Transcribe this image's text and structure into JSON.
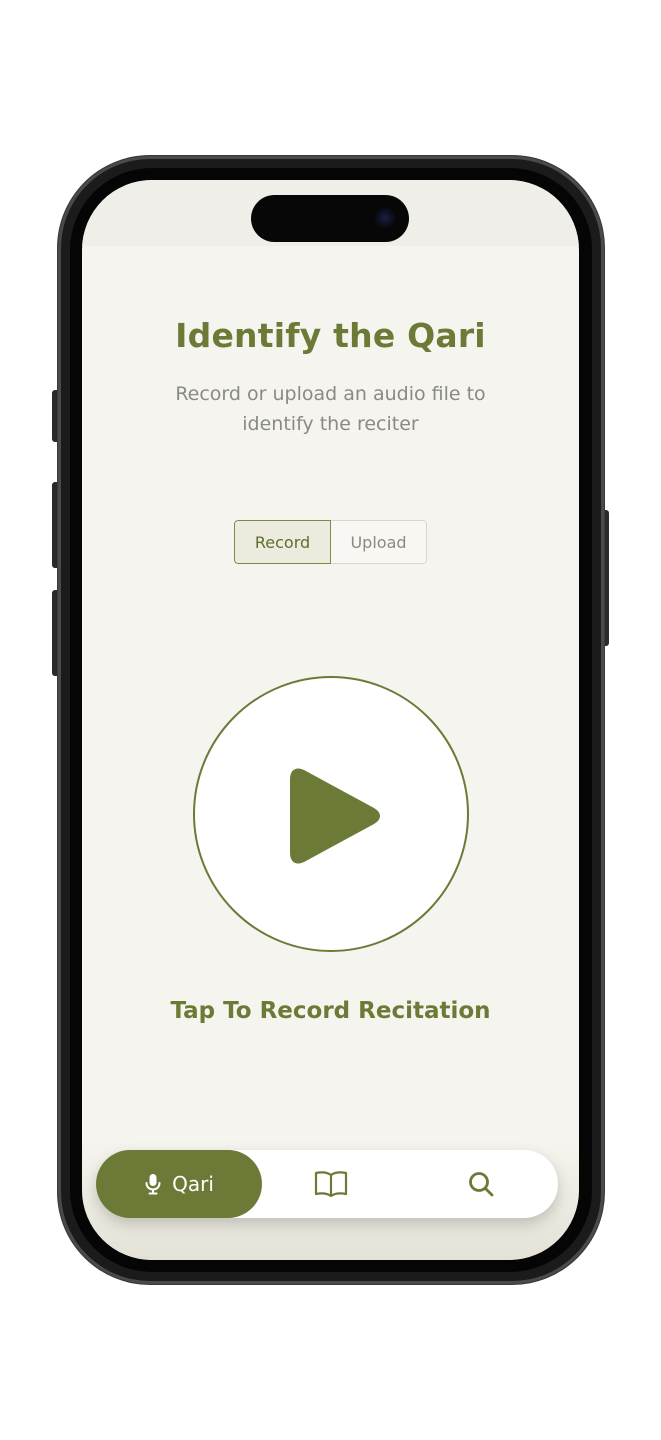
{
  "header": {
    "title": "Identify the Qari",
    "subtitle": "Record or upload an audio file to identify the reciter"
  },
  "mode_toggle": {
    "options": [
      {
        "label": "Record",
        "selected": true
      },
      {
        "label": "Upload",
        "selected": false
      }
    ]
  },
  "recorder": {
    "icon": "play-icon",
    "caption": "Tap To Record Recitation"
  },
  "tabbar": {
    "items": [
      {
        "label": "Qari",
        "icon": "microphone-icon",
        "active": true
      },
      {
        "label": "",
        "icon": "book-open-icon",
        "active": false
      },
      {
        "label": "",
        "icon": "search-icon",
        "active": false
      }
    ]
  },
  "colors": {
    "accent": "#6b7a36",
    "screen_background": "#f5f4ee",
    "muted_text": "#8a8a84",
    "tabbar_background": "#ffffff"
  }
}
